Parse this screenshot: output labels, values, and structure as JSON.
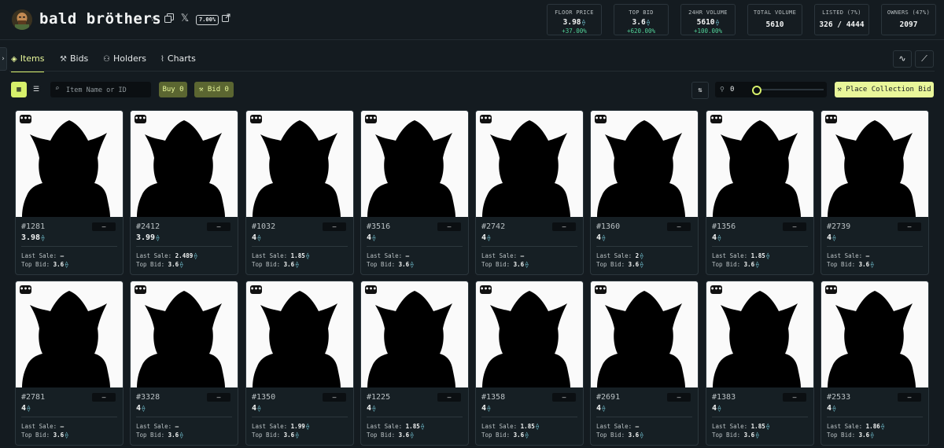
{
  "collection": {
    "name": "bald bröthers",
    "royalty": "7.00%",
    "avatar": "bald-avatar"
  },
  "header_icons": [
    "star-icon",
    "copy-icon",
    "x-logo-icon",
    "external-link-icon"
  ],
  "stats": [
    {
      "label": "FLOOR PRICE",
      "value": "3.98",
      "currency": true,
      "change": "+37.00%"
    },
    {
      "label": "TOP BID",
      "value": "3.6",
      "currency": true,
      "change": "+620.00%"
    },
    {
      "label": "24HR VOLUME",
      "value": "5610",
      "currency": true,
      "change": "+100.00%"
    },
    {
      "label": "TOTAL VOLUME",
      "value": "5610",
      "currency": false,
      "change": ""
    },
    {
      "label": "LISTED (7%)",
      "value": "326 / 4444",
      "currency": false,
      "change": ""
    },
    {
      "label": "OWNERS (47%)",
      "value": "2097",
      "currency": false,
      "change": ""
    }
  ],
  "tabs": [
    {
      "label": "Items",
      "active": true
    },
    {
      "label": "Bids",
      "active": false
    },
    {
      "label": "Holders",
      "active": false
    },
    {
      "label": "Charts",
      "active": false
    }
  ],
  "toolbar": {
    "search_placeholder": "Item Name or ID",
    "buy_label": "Buy 0",
    "bid_label": "Bid 0",
    "sweep_value": "0",
    "sweep_level": 0,
    "place_bid_label": "Place Collection Bid"
  },
  "currency_symbol": "⟠",
  "labels": {
    "last_sale": "Last Sale:",
    "top_bid": "Top Bid:",
    "buy_button": "–",
    "menu_button": "•••"
  },
  "items": [
    {
      "id": "#1281",
      "price": "3.98",
      "last_sale": "–",
      "top_bid": "3.6"
    },
    {
      "id": "#2412",
      "price": "3.99",
      "last_sale": "2.489",
      "top_bid": "3.6"
    },
    {
      "id": "#1032",
      "price": "4",
      "last_sale": "1.85",
      "top_bid": "3.6"
    },
    {
      "id": "#3516",
      "price": "4",
      "last_sale": "–",
      "top_bid": "3.6"
    },
    {
      "id": "#2742",
      "price": "4",
      "last_sale": "–",
      "top_bid": "3.6"
    },
    {
      "id": "#1360",
      "price": "4",
      "last_sale": "2",
      "top_bid": "3.6"
    },
    {
      "id": "#1356",
      "price": "4",
      "last_sale": "1.85",
      "top_bid": "3.6"
    },
    {
      "id": "#2739",
      "price": "4",
      "last_sale": "–",
      "top_bid": "3.6"
    },
    {
      "id": "#2781",
      "price": "4",
      "last_sale": "–",
      "top_bid": "3.6"
    },
    {
      "id": "#3328",
      "price": "4",
      "last_sale": "–",
      "top_bid": "3.6"
    },
    {
      "id": "#1350",
      "price": "4",
      "last_sale": "1.99",
      "top_bid": "3.6"
    },
    {
      "id": "#1225",
      "price": "4",
      "last_sale": "1.85",
      "top_bid": "3.6"
    },
    {
      "id": "#1358",
      "price": "4",
      "last_sale": "1.85",
      "top_bid": "3.6"
    },
    {
      "id": "#2691",
      "price": "4",
      "last_sale": "–",
      "top_bid": "3.6"
    },
    {
      "id": "#1383",
      "price": "4",
      "last_sale": "1.85",
      "top_bid": "3.6"
    },
    {
      "id": "#2533",
      "price": "4",
      "last_sale": "1.86",
      "top_bid": "3.6"
    }
  ]
}
